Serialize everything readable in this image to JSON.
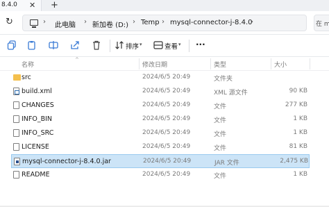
{
  "tab": {
    "title": "8.4.0",
    "close_glyph": "✕",
    "add_glyph": "+"
  },
  "nav": {
    "refresh_glyph": "↻"
  },
  "address": {
    "icon": "pc-icon",
    "breadcrumbs": [
      "此电脑",
      "新加卷 (D:)",
      "Temp",
      "mysql-connector-j-8.4.0"
    ],
    "separator": "›",
    "search_placeholder": "在 m"
  },
  "toolbar": {
    "sort_label": "排序",
    "view_label": "查看",
    "more_glyph": "···"
  },
  "columns": {
    "name": "名称",
    "date": "修改日期",
    "type": "类型",
    "size": "大小"
  },
  "files": [
    {
      "name": "src",
      "date": "2024/6/5 20:49",
      "type": "文件夹",
      "size": "",
      "icon": "folder"
    },
    {
      "name": "build.xml",
      "date": "2024/6/5 20:49",
      "type": "XML 源文件",
      "size": "90 KB",
      "icon": "xml"
    },
    {
      "name": "CHANGES",
      "date": "2024/6/5 20:49",
      "type": "文件",
      "size": "277 KB",
      "icon": "doc"
    },
    {
      "name": "INFO_BIN",
      "date": "2024/6/5 20:49",
      "type": "文件",
      "size": "1 KB",
      "icon": "doc"
    },
    {
      "name": "INFO_SRC",
      "date": "2024/6/5 20:49",
      "type": "文件",
      "size": "1 KB",
      "icon": "doc"
    },
    {
      "name": "LICENSE",
      "date": "2024/6/5 20:49",
      "type": "文件",
      "size": "81 KB",
      "icon": "doc"
    },
    {
      "name": "mysql-connector-j-8.4.0.jar",
      "date": "2024/6/5 20:49",
      "type": "JAR 文件",
      "size": "2,475 KB",
      "icon": "jar",
      "selected": true
    },
    {
      "name": "README",
      "date": "2024/6/5 20:49",
      "type": "文件",
      "size": "1 KB",
      "icon": "doc"
    }
  ]
}
